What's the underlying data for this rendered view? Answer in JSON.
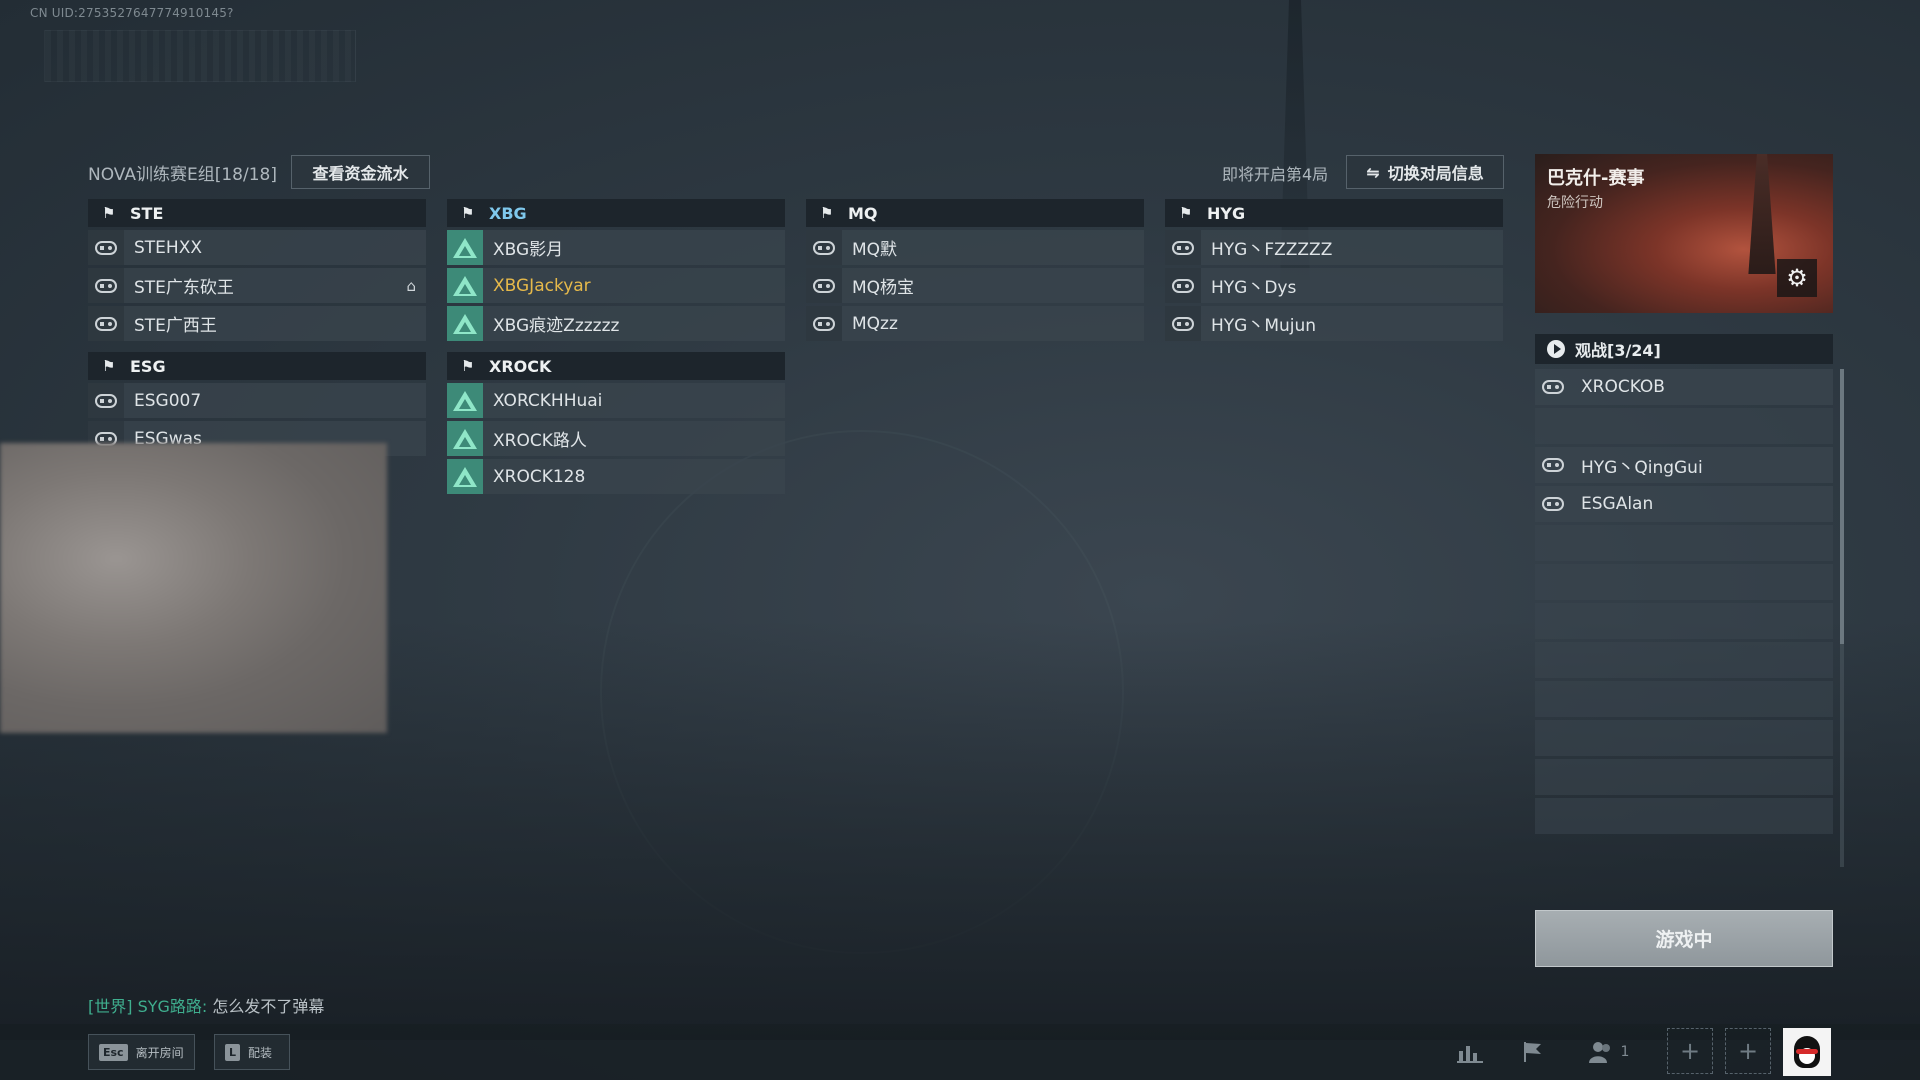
{
  "uid": "CN UID:2753527647774910145?",
  "header": {
    "room_title": "NOVA训练赛E组[18/18]",
    "funds_button": "查看资金流水",
    "round_hint": "即将开启第4局",
    "switch_button": "切换对局信息"
  },
  "teams": [
    {
      "name": "STE",
      "active": false,
      "players": [
        {
          "name": "STEHXX",
          "icon": "gamepad-icon"
        },
        {
          "name": "STE广东砍王",
          "icon": "gamepad-icon",
          "host": true
        },
        {
          "name": "STE广西王",
          "icon": "gamepad-icon"
        }
      ]
    },
    {
      "name": "XBG",
      "active": true,
      "players": [
        {
          "name": "XBG影月",
          "icon": "triangle-logo-icon"
        },
        {
          "name": "XBGJackyar",
          "icon": "triangle-logo-icon",
          "me": true
        },
        {
          "name": "XBG痕迹Zzzzzz",
          "icon": "triangle-logo-icon"
        }
      ]
    },
    {
      "name": "MQ",
      "active": false,
      "players": [
        {
          "name": "MQ默",
          "icon": "gamepad-icon"
        },
        {
          "name": "MQ杨宝",
          "icon": "gamepad-icon"
        },
        {
          "name": "MQzz",
          "icon": "gamepad-icon"
        }
      ]
    },
    {
      "name": "HYG",
      "active": false,
      "players": [
        {
          "name": "HYG丶FZZZZZ",
          "icon": "gamepad-icon"
        },
        {
          "name": "HYG丶Dys",
          "icon": "gamepad-icon"
        },
        {
          "name": "HYG丶Mujun",
          "icon": "gamepad-icon"
        }
      ]
    },
    {
      "name": "ESG",
      "active": false,
      "players": [
        {
          "name": "ESG007",
          "icon": "gamepad-icon"
        },
        {
          "name": "ESGwas",
          "icon": "gamepad-icon"
        }
      ]
    },
    {
      "name": "XROCK",
      "active": false,
      "players": [
        {
          "name": "XORCKHHuai",
          "icon": "triangle-logo-icon"
        },
        {
          "name": "XROCK路人",
          "icon": "triangle-logo-icon"
        },
        {
          "name": "XROCK128",
          "icon": "triangle-logo-icon"
        }
      ]
    }
  ],
  "map": {
    "name": "巴克什-赛事",
    "mode": "危险行动"
  },
  "spectators": {
    "header": "观战[3/24]",
    "slots": [
      "XROCKOB",
      "",
      "HYG丶QingGui",
      "ESGAlan",
      "",
      "",
      "",
      "",
      "",
      "",
      "",
      ""
    ]
  },
  "status_button": "游戏中",
  "chat": {
    "channel": "[世界]",
    "user": "SYG路路:",
    "message": "怎么发不了弹幕"
  },
  "bottom": {
    "esc_key": "Esc",
    "esc_label": "离开房间",
    "l_key": "L",
    "l_label": "配装",
    "friends_count": "1"
  },
  "colors": {
    "active_team": "#7fc8ec",
    "self_player": "#e6b94a",
    "chat_channel": "#3fae8e",
    "triangle_logo": "#8fe6c8"
  }
}
